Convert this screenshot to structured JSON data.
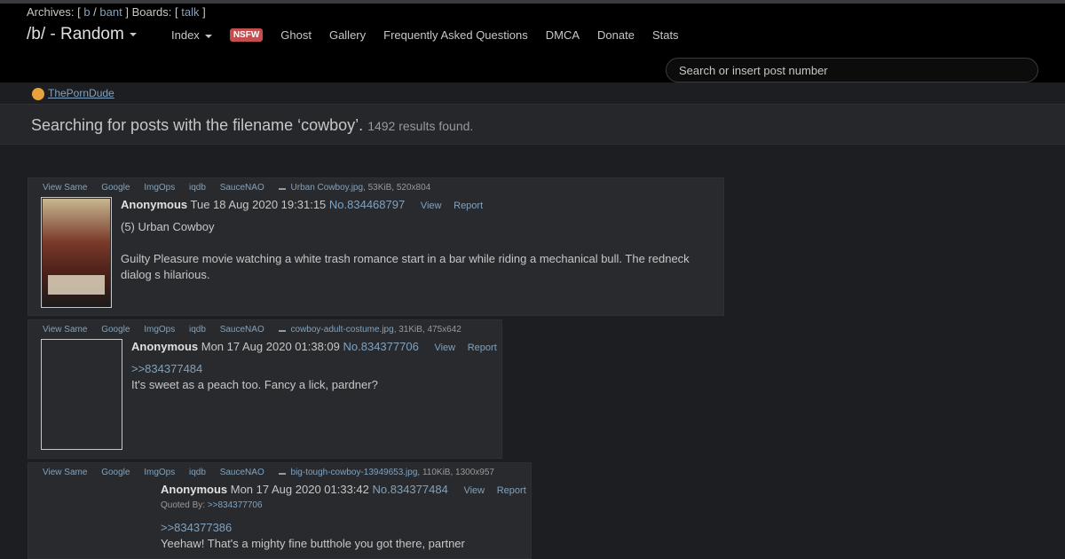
{
  "nav": {
    "archives_label": "Archives: [",
    "archive_b": "b",
    "archive_sep": "/",
    "archive_bant": "bant",
    "boards_label": "] Boards: [",
    "board_talk": "talk",
    "close_bracket": "]",
    "board_title": "/b/ - Random",
    "index": "Index",
    "nsfw_badge": "NSFW",
    "ghost": "Ghost",
    "gallery": "Gallery",
    "faq": "Frequently Asked Questions",
    "dmca": "DMCA",
    "donate": "Donate",
    "stats": "Stats",
    "search_placeholder": "Search or insert post number"
  },
  "sponsor": {
    "label": "ThePornDude"
  },
  "results": {
    "message": "Searching for posts with the filename ‘cowboy’.",
    "count": "1492 results found."
  },
  "link_labels": {
    "view_same": "View Same",
    "google": "Google",
    "imgops": "ImgOps",
    "iqdb": "iqdb",
    "saucenao": "SauceNAO",
    "view": "View",
    "report": "Report",
    "quoted_by": "Quoted By:"
  },
  "posts": [
    {
      "filename": "Urban Cowboy.jpg",
      "fileinfo": ", 53KiB, 520x804",
      "name": "Anonymous",
      "date": "Tue 18 Aug 2020 19:31:15",
      "number": "No.834468797",
      "line1": "(5) Urban Cowboy",
      "line2": "Guilty Pleasure movie watching a white trash romance start in a bar while riding a mechanical bull. The redneck dialog s hilarious."
    },
    {
      "filename": "cowboy-adult-costume.jpg",
      "fileinfo": ", 31KiB, 475x642",
      "name": "Anonymous",
      "date": "Mon 17 Aug 2020 01:38:09",
      "number": "No.834377706",
      "quote": ">>834377484",
      "line1": "It's sweet as a peach too. Fancy a lick, pardner?"
    },
    {
      "filename": "big-tough-cowboy-13949653.jpg",
      "fileinfo": ", 110KiB, 1300x957",
      "name": "Anonymous",
      "date": "Mon 17 Aug 2020 01:33:42",
      "number": "No.834377484",
      "quoted_by": ">>834377706",
      "quote": ">>834377386",
      "line1": "Yeehaw! That's a mighty fine butthole you got there, partner"
    }
  ]
}
